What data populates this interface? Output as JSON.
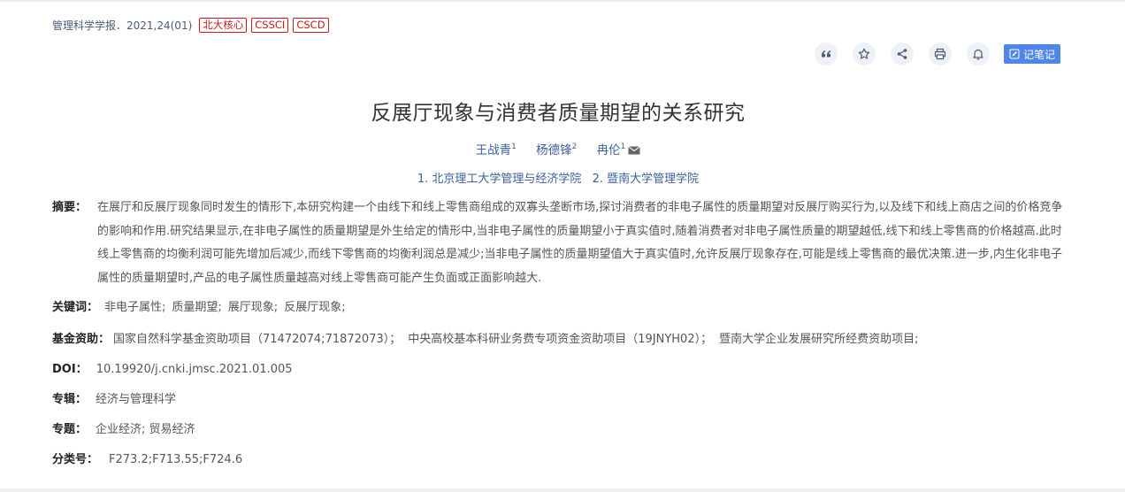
{
  "source": {
    "journal": "管理科学学报．2021,24(01)",
    "tags": [
      "北大核心",
      "CSSCI",
      "CSCD"
    ]
  },
  "toolbar": {
    "icons": [
      "quote-icon",
      "star-icon",
      "share-icon",
      "print-icon",
      "bell-icon"
    ],
    "note_label": "记笔记",
    "accent": "#4f86e8"
  },
  "title": "反展厅现象与消费者质量期望的关系研究",
  "authors": [
    {
      "name": "王战青",
      "sup": "1"
    },
    {
      "name": "杨德锋",
      "sup": "2"
    },
    {
      "name": "冉伦",
      "sup": "1"
    }
  ],
  "affiliations": [
    "1. 北京理工大学管理与经济学院",
    "2. 暨南大学管理学院"
  ],
  "abstract": {
    "label": "摘要：",
    "text": "在展厅和反展厅现象同时发生的情形下,本研究构建一个由线下和线上零售商组成的双寡头垄断市场,探讨消费者的非电子属性的质量期望对反展厅购买行为,以及线下和线上商店之间的价格竞争的影响和作用.研究结果显示,在非电子属性的质量期望是外生给定的情形中,当非电子属性的质量期望小于真实值时,随着消费者对非电子属性质量的期望越低,线下和线上零售商的价格越高.此时线上零售商的均衡利润可能先增加后减少,而线下零售商的均衡利润总是减少;当非电子属性的质量期望值大于真实值时,允许反展厅现象存在,可能是线上零售商的最优决策.进一步,内生化非电子属性的质量期望时,产品的电子属性质量越高对线上零售商可能产生负面或正面影响越大."
  },
  "keywords": {
    "label": "关键词：",
    "items": [
      "非电子属性;",
      "质量期望;",
      "展厅现象;",
      "反展厅现象;"
    ]
  },
  "funding": {
    "label": "基金资助：",
    "items": [
      "国家自然科学基金资助项目（71472074;71872073）；",
      "中央高校基本科研业务费专项资金资助项目（19JNYH02）；",
      "暨南大学企业发展研究所经费资助项目;"
    ]
  },
  "doi": {
    "label": "DOI：",
    "value": "10.19920/j.cnki.jmsc.2021.01.005"
  },
  "special": {
    "label": "专辑：",
    "value": "经济与管理科学"
  },
  "topic": {
    "label": "专题：",
    "value": "企业经济; 贸易经济"
  },
  "classification": {
    "label": "分类号：",
    "value": "F273.2;F713.55;F724.6"
  }
}
